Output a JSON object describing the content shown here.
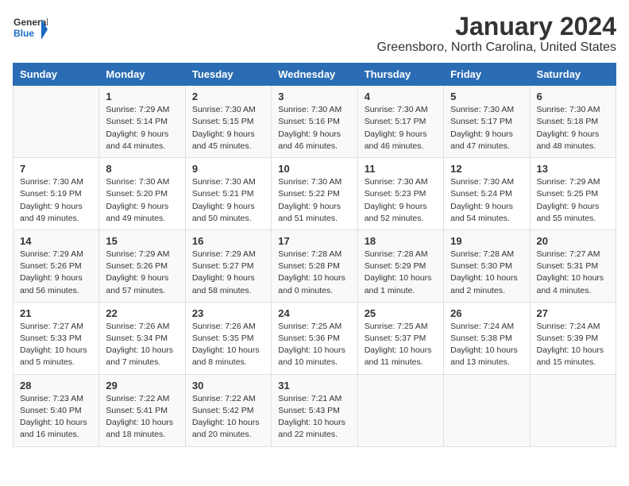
{
  "logo": {
    "text_general": "General",
    "text_blue": "Blue"
  },
  "title": "January 2024",
  "subtitle": "Greensboro, North Carolina, United States",
  "days_header": [
    "Sunday",
    "Monday",
    "Tuesday",
    "Wednesday",
    "Thursday",
    "Friday",
    "Saturday"
  ],
  "weeks": [
    [
      {
        "day": "",
        "sunrise": "",
        "sunset": "",
        "daylight": ""
      },
      {
        "day": "1",
        "sunrise": "Sunrise: 7:29 AM",
        "sunset": "Sunset: 5:14 PM",
        "daylight": "Daylight: 9 hours and 44 minutes."
      },
      {
        "day": "2",
        "sunrise": "Sunrise: 7:30 AM",
        "sunset": "Sunset: 5:15 PM",
        "daylight": "Daylight: 9 hours and 45 minutes."
      },
      {
        "day": "3",
        "sunrise": "Sunrise: 7:30 AM",
        "sunset": "Sunset: 5:16 PM",
        "daylight": "Daylight: 9 hours and 46 minutes."
      },
      {
        "day": "4",
        "sunrise": "Sunrise: 7:30 AM",
        "sunset": "Sunset: 5:17 PM",
        "daylight": "Daylight: 9 hours and 46 minutes."
      },
      {
        "day": "5",
        "sunrise": "Sunrise: 7:30 AM",
        "sunset": "Sunset: 5:17 PM",
        "daylight": "Daylight: 9 hours and 47 minutes."
      },
      {
        "day": "6",
        "sunrise": "Sunrise: 7:30 AM",
        "sunset": "Sunset: 5:18 PM",
        "daylight": "Daylight: 9 hours and 48 minutes."
      }
    ],
    [
      {
        "day": "7",
        "sunrise": "Sunrise: 7:30 AM",
        "sunset": "Sunset: 5:19 PM",
        "daylight": "Daylight: 9 hours and 49 minutes."
      },
      {
        "day": "8",
        "sunrise": "Sunrise: 7:30 AM",
        "sunset": "Sunset: 5:20 PM",
        "daylight": "Daylight: 9 hours and 49 minutes."
      },
      {
        "day": "9",
        "sunrise": "Sunrise: 7:30 AM",
        "sunset": "Sunset: 5:21 PM",
        "daylight": "Daylight: 9 hours and 50 minutes."
      },
      {
        "day": "10",
        "sunrise": "Sunrise: 7:30 AM",
        "sunset": "Sunset: 5:22 PM",
        "daylight": "Daylight: 9 hours and 51 minutes."
      },
      {
        "day": "11",
        "sunrise": "Sunrise: 7:30 AM",
        "sunset": "Sunset: 5:23 PM",
        "daylight": "Daylight: 9 hours and 52 minutes."
      },
      {
        "day": "12",
        "sunrise": "Sunrise: 7:30 AM",
        "sunset": "Sunset: 5:24 PM",
        "daylight": "Daylight: 9 hours and 54 minutes."
      },
      {
        "day": "13",
        "sunrise": "Sunrise: 7:29 AM",
        "sunset": "Sunset: 5:25 PM",
        "daylight": "Daylight: 9 hours and 55 minutes."
      }
    ],
    [
      {
        "day": "14",
        "sunrise": "Sunrise: 7:29 AM",
        "sunset": "Sunset: 5:26 PM",
        "daylight": "Daylight: 9 hours and 56 minutes."
      },
      {
        "day": "15",
        "sunrise": "Sunrise: 7:29 AM",
        "sunset": "Sunset: 5:26 PM",
        "daylight": "Daylight: 9 hours and 57 minutes."
      },
      {
        "day": "16",
        "sunrise": "Sunrise: 7:29 AM",
        "sunset": "Sunset: 5:27 PM",
        "daylight": "Daylight: 9 hours and 58 minutes."
      },
      {
        "day": "17",
        "sunrise": "Sunrise: 7:28 AM",
        "sunset": "Sunset: 5:28 PM",
        "daylight": "Daylight: 10 hours and 0 minutes."
      },
      {
        "day": "18",
        "sunrise": "Sunrise: 7:28 AM",
        "sunset": "Sunset: 5:29 PM",
        "daylight": "Daylight: 10 hours and 1 minute."
      },
      {
        "day": "19",
        "sunrise": "Sunrise: 7:28 AM",
        "sunset": "Sunset: 5:30 PM",
        "daylight": "Daylight: 10 hours and 2 minutes."
      },
      {
        "day": "20",
        "sunrise": "Sunrise: 7:27 AM",
        "sunset": "Sunset: 5:31 PM",
        "daylight": "Daylight: 10 hours and 4 minutes."
      }
    ],
    [
      {
        "day": "21",
        "sunrise": "Sunrise: 7:27 AM",
        "sunset": "Sunset: 5:33 PM",
        "daylight": "Daylight: 10 hours and 5 minutes."
      },
      {
        "day": "22",
        "sunrise": "Sunrise: 7:26 AM",
        "sunset": "Sunset: 5:34 PM",
        "daylight": "Daylight: 10 hours and 7 minutes."
      },
      {
        "day": "23",
        "sunrise": "Sunrise: 7:26 AM",
        "sunset": "Sunset: 5:35 PM",
        "daylight": "Daylight: 10 hours and 8 minutes."
      },
      {
        "day": "24",
        "sunrise": "Sunrise: 7:25 AM",
        "sunset": "Sunset: 5:36 PM",
        "daylight": "Daylight: 10 hours and 10 minutes."
      },
      {
        "day": "25",
        "sunrise": "Sunrise: 7:25 AM",
        "sunset": "Sunset: 5:37 PM",
        "daylight": "Daylight: 10 hours and 11 minutes."
      },
      {
        "day": "26",
        "sunrise": "Sunrise: 7:24 AM",
        "sunset": "Sunset: 5:38 PM",
        "daylight": "Daylight: 10 hours and 13 minutes."
      },
      {
        "day": "27",
        "sunrise": "Sunrise: 7:24 AM",
        "sunset": "Sunset: 5:39 PM",
        "daylight": "Daylight: 10 hours and 15 minutes."
      }
    ],
    [
      {
        "day": "28",
        "sunrise": "Sunrise: 7:23 AM",
        "sunset": "Sunset: 5:40 PM",
        "daylight": "Daylight: 10 hours and 16 minutes."
      },
      {
        "day": "29",
        "sunrise": "Sunrise: 7:22 AM",
        "sunset": "Sunset: 5:41 PM",
        "daylight": "Daylight: 10 hours and 18 minutes."
      },
      {
        "day": "30",
        "sunrise": "Sunrise: 7:22 AM",
        "sunset": "Sunset: 5:42 PM",
        "daylight": "Daylight: 10 hours and 20 minutes."
      },
      {
        "day": "31",
        "sunrise": "Sunrise: 7:21 AM",
        "sunset": "Sunset: 5:43 PM",
        "daylight": "Daylight: 10 hours and 22 minutes."
      },
      {
        "day": "",
        "sunrise": "",
        "sunset": "",
        "daylight": ""
      },
      {
        "day": "",
        "sunrise": "",
        "sunset": "",
        "daylight": ""
      },
      {
        "day": "",
        "sunrise": "",
        "sunset": "",
        "daylight": ""
      }
    ]
  ]
}
